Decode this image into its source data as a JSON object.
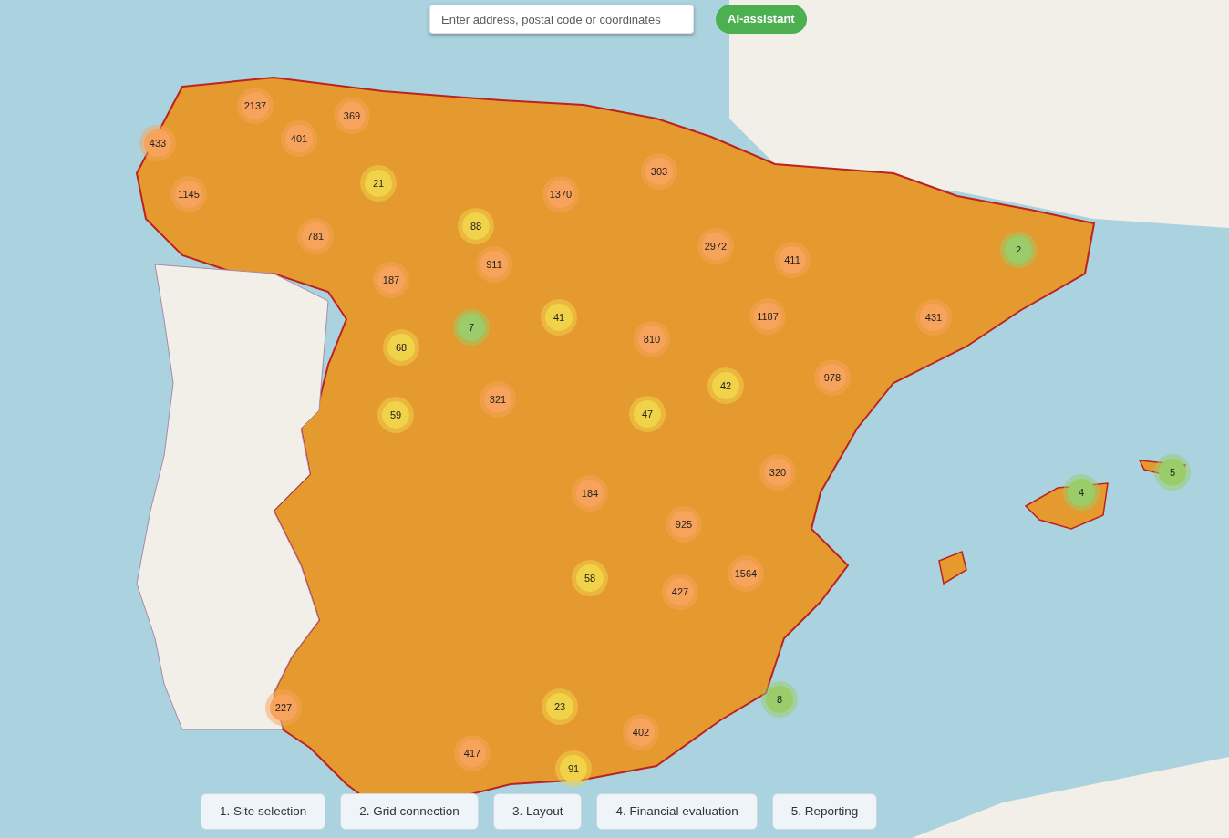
{
  "search": {
    "placeholder": "Enter address, postal code or coordinates"
  },
  "assistant_button": "AI-assistant",
  "clusters": [
    {
      "count": "2137",
      "color": "#f7a35c"
    },
    {
      "count": "433",
      "color": "#f7a35c"
    },
    {
      "count": "401",
      "color": "#f7a35c"
    },
    {
      "count": "369",
      "color": "#f7a35c"
    },
    {
      "count": "1145",
      "color": "#f7a35c"
    },
    {
      "count": "21",
      "color": "#f1d34a"
    },
    {
      "count": "88",
      "color": "#f1d34a"
    },
    {
      "count": "781",
      "color": "#f7a35c"
    },
    {
      "count": "1370",
      "color": "#f7a35c"
    },
    {
      "count": "303",
      "color": "#f7a35c"
    },
    {
      "count": "187",
      "color": "#f7a35c"
    },
    {
      "count": "911",
      "color": "#f7a35c"
    },
    {
      "count": "2972",
      "color": "#f7a35c"
    },
    {
      "count": "411",
      "color": "#f7a35c"
    },
    {
      "count": "2",
      "color": "#9acd6a"
    },
    {
      "count": "7",
      "color": "#9acd6a"
    },
    {
      "count": "41",
      "color": "#f1d34a"
    },
    {
      "count": "68",
      "color": "#f1d34a"
    },
    {
      "count": "810",
      "color": "#f7a35c"
    },
    {
      "count": "1187",
      "color": "#f7a35c"
    },
    {
      "count": "431",
      "color": "#f7a35c"
    },
    {
      "count": "978",
      "color": "#f7a35c"
    },
    {
      "count": "42",
      "color": "#f1d34a"
    },
    {
      "count": "321",
      "color": "#f7a35c"
    },
    {
      "count": "59",
      "color": "#f1d34a"
    },
    {
      "count": "47",
      "color": "#f1d34a"
    },
    {
      "count": "320",
      "color": "#f7a35c"
    },
    {
      "count": "184",
      "color": "#f7a35c"
    },
    {
      "count": "925",
      "color": "#f7a35c"
    },
    {
      "count": "4",
      "color": "#9acd6a"
    },
    {
      "count": "5",
      "color": "#9acd6a"
    },
    {
      "count": "58",
      "color": "#f1d34a"
    },
    {
      "count": "1564",
      "color": "#f7a35c"
    },
    {
      "count": "427",
      "color": "#f7a35c"
    },
    {
      "count": "227",
      "color": "#f7a35c"
    },
    {
      "count": "8",
      "color": "#9acd6a"
    },
    {
      "count": "23",
      "color": "#f1d34a"
    },
    {
      "count": "402",
      "color": "#f7a35c"
    },
    {
      "count": "417",
      "color": "#f7a35c"
    },
    {
      "count": "91",
      "color": "#f1d34a"
    }
  ],
  "steps": [
    "1. Site selection",
    "2. Grid connection",
    "3. Layout",
    "4. Financial evaluation",
    "5. Reporting"
  ]
}
